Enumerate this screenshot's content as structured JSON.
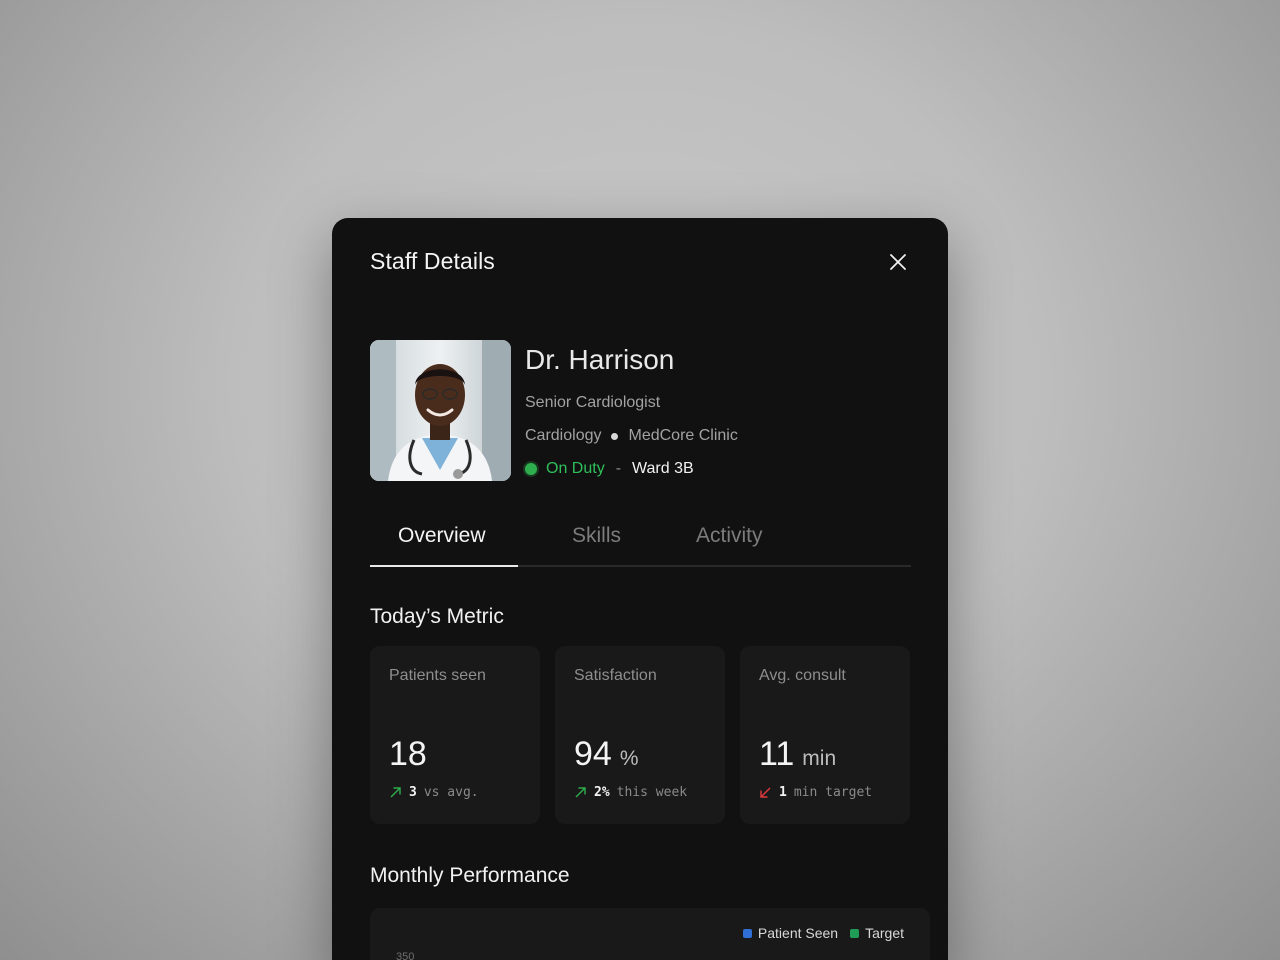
{
  "modal": {
    "title": "Staff Details"
  },
  "profile": {
    "name": "Dr. Harrison",
    "role": "Senior Cardiologist",
    "department": "Cardiology",
    "clinic": "MedCore Clinic",
    "status": "On Duty",
    "status_separator": "-",
    "ward": "Ward 3B",
    "status_color": "#2fbf5a"
  },
  "tabs": [
    {
      "label": "Overview",
      "active": true
    },
    {
      "label": "Skills",
      "active": false
    },
    {
      "label": "Activity",
      "active": false
    }
  ],
  "metrics": {
    "section_title": "Today’s Metric",
    "cards": [
      {
        "label": "Patients seen",
        "value": "18",
        "unit": "",
        "delta_dir": "up",
        "delta_value": "3",
        "delta_text": "vs avg."
      },
      {
        "label": "Satisfaction",
        "value": "94",
        "unit": "%",
        "delta_dir": "up",
        "delta_value": "2%",
        "delta_text": "this week"
      },
      {
        "label": "Avg. consult",
        "value": "11",
        "unit": "min",
        "delta_dir": "down",
        "delta_value": "1",
        "delta_text": "min target"
      }
    ]
  },
  "performance": {
    "section_title": "Monthly Performance",
    "legend": [
      {
        "label": "Patient Seen",
        "color": "#2f6fd6"
      },
      {
        "label": "Target",
        "color": "#1f9d57"
      }
    ],
    "y_top_tick": "350"
  },
  "colors": {
    "up": "#2fae4e",
    "down": "#e0383e"
  }
}
